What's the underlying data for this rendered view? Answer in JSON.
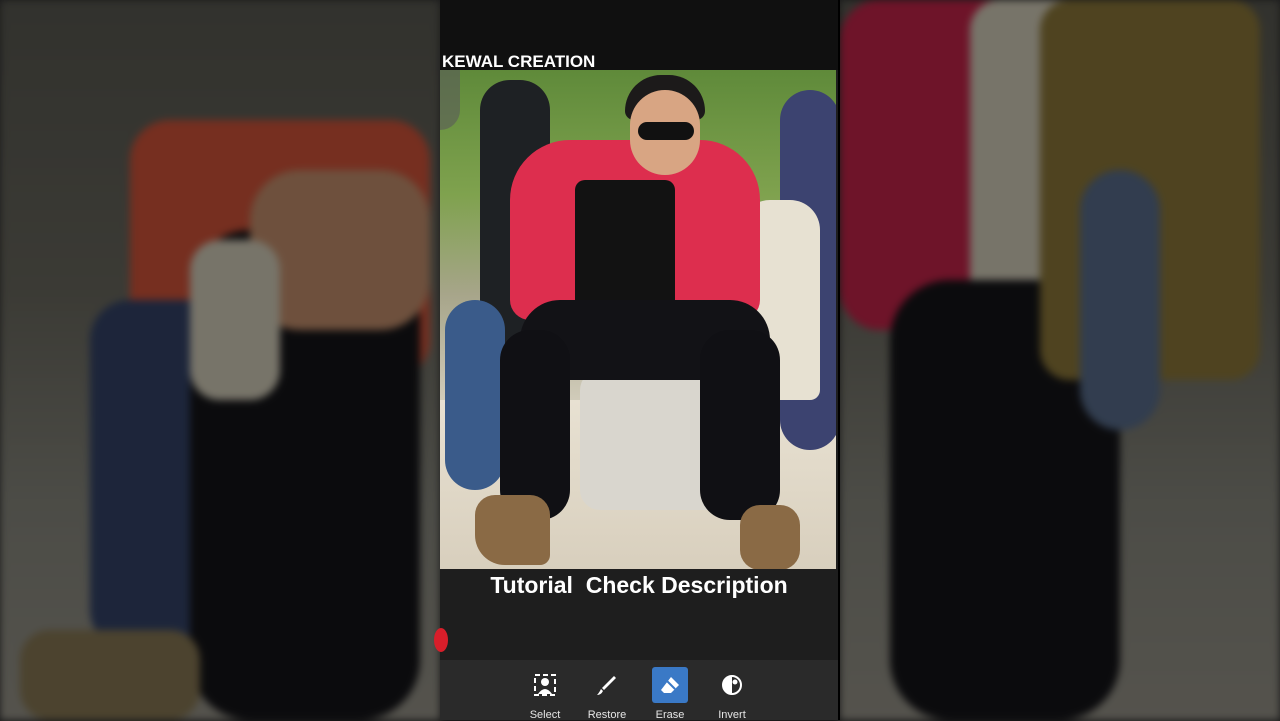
{
  "watermark": "KEWAL CREATION",
  "caption": "Tutorial  Check Description",
  "toolbar": {
    "items": [
      {
        "label": "Select",
        "icon": "select-person-icon"
      },
      {
        "label": "Restore",
        "icon": "brush-icon"
      },
      {
        "label": "Erase",
        "icon": "eraser-icon"
      },
      {
        "label": "Invert",
        "icon": "invert-icon"
      }
    ],
    "active": "Erase"
  },
  "colors": {
    "accent": "#3a79c6",
    "jacket": "#dd2e4e",
    "background": "#1e1e1e"
  }
}
